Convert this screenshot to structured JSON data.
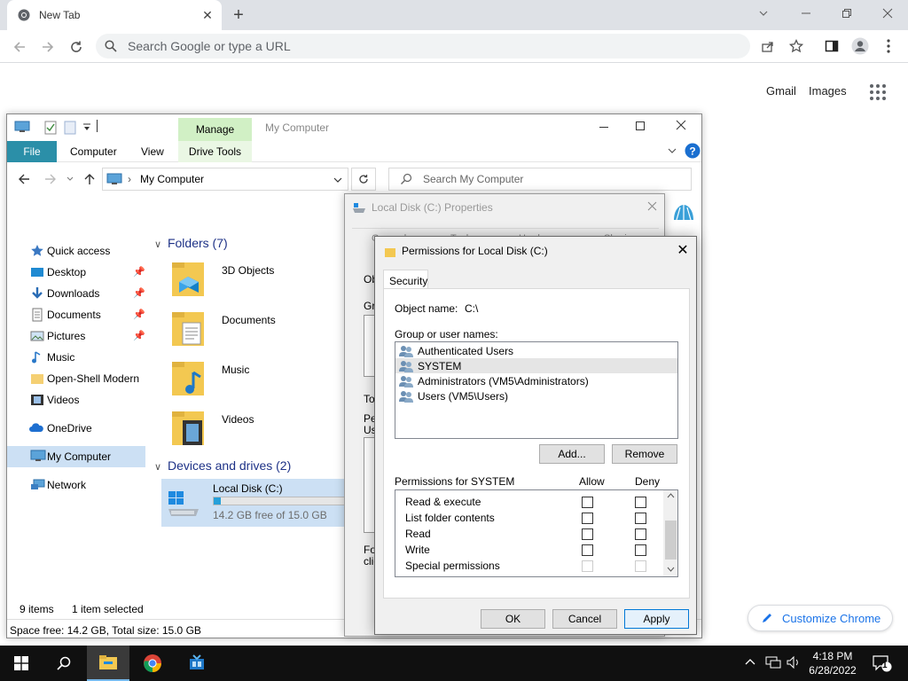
{
  "browser": {
    "tab_title": "New Tab",
    "omnibox_placeholder": "Search Google or type a URL",
    "links": {
      "gmail": "Gmail",
      "images": "Images"
    },
    "customize_label": "Customize Chrome"
  },
  "explorer": {
    "manage_label": "Manage",
    "window_title": "My Computer",
    "ribbon_tabs": [
      "File",
      "Computer",
      "View",
      "Drive Tools"
    ],
    "address": "My Computer",
    "search_placeholder": "Search My Computer",
    "nav": [
      {
        "label": "Quick access",
        "icon": "star-icon"
      },
      {
        "label": "Desktop",
        "icon": "desktop-icon",
        "pinned": true
      },
      {
        "label": "Downloads",
        "icon": "download-icon",
        "pinned": true
      },
      {
        "label": "Documents",
        "icon": "documents-icon",
        "pinned": true
      },
      {
        "label": "Pictures",
        "icon": "pictures-icon",
        "pinned": true
      },
      {
        "label": "Music",
        "icon": "music-icon"
      },
      {
        "label": "Open-Shell Modern",
        "icon": "folder-icon"
      },
      {
        "label": "Videos",
        "icon": "videos-icon"
      },
      {
        "label": "OneDrive",
        "icon": "cloud-icon"
      },
      {
        "label": "My Computer",
        "icon": "computer-icon",
        "selected": true
      },
      {
        "label": "Network",
        "icon": "network-icon"
      }
    ],
    "folders_header": "Folders (7)",
    "folders": [
      "3D Objects",
      "Documents",
      "Music",
      "Videos"
    ],
    "devices_header": "Devices and drives (2)",
    "drive": {
      "name": "Local Disk (C:)",
      "free_text": "14.2 GB free of 15.0 GB",
      "used_fraction": 0.053
    },
    "status_items": "9 items",
    "status_selected": "1 item selected",
    "space_text": "Space free: 14.2 GB, Total size: 15.0 GB"
  },
  "properties": {
    "title": "Local Disk (C:) Properties",
    "tabs": [
      "General",
      "Tools",
      "Hardware",
      "Sharing"
    ],
    "partial_labels": [
      "Ob",
      "Gro",
      "To",
      "Pe",
      "Us",
      "Fo",
      "clic"
    ]
  },
  "permissions": {
    "title": "Permissions for Local Disk (C:)",
    "tab": "Security",
    "object_label": "Object name:",
    "object_value": "C:\\",
    "group_label": "Group or user names:",
    "users": [
      "Authenticated Users",
      "SYSTEM",
      "Administrators (VM5\\Administrators)",
      "Users (VM5\\Users)"
    ],
    "selected_user_index": 1,
    "add_button": "Add...",
    "remove_button": "Remove",
    "perm_header": "Permissions for SYSTEM",
    "allow_header": "Allow",
    "deny_header": "Deny",
    "perms": [
      {
        "name": "Read & execute"
      },
      {
        "name": "List folder contents"
      },
      {
        "name": "Read"
      },
      {
        "name": "Write"
      },
      {
        "name": "Special permissions",
        "disabled": true
      }
    ],
    "ok_button": "OK",
    "cancel_button": "Cancel",
    "apply_button": "Apply"
  },
  "taskbar": {
    "time": "4:18 PM",
    "date": "6/28/2022",
    "notification_count": "1"
  }
}
